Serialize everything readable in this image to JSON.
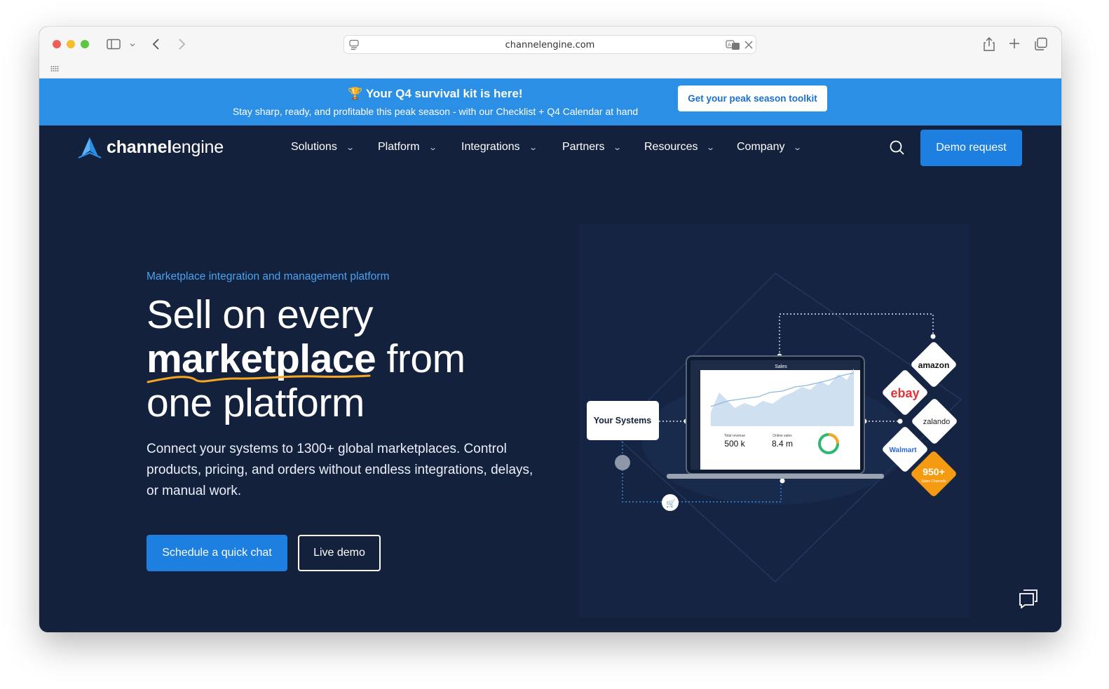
{
  "browser": {
    "url": "channelengine.com",
    "icons": [
      "sidebar-icon",
      "chevron-down-icon",
      "back-icon",
      "forward-icon",
      "page-menu-icon",
      "translate-icon",
      "close-icon",
      "share-icon",
      "new-tab-icon",
      "tabs-overview-icon",
      "extensions-grid-icon"
    ]
  },
  "banner": {
    "title": "🏆 Your Q4 survival kit is here!",
    "subtitle": "Stay sharp, ready, and profitable this peak season - with our Checklist + Q4 Calendar at hand",
    "button": "Get your peak season toolkit",
    "color": "#2b8fe5"
  },
  "nav": {
    "logo_bold": "channel",
    "logo_light": "engine",
    "items": [
      {
        "label": "Solutions"
      },
      {
        "label": "Platform"
      },
      {
        "label": "Integrations"
      },
      {
        "label": "Partners"
      },
      {
        "label": "Resources"
      },
      {
        "label": "Company"
      }
    ],
    "demo_button": "Demo request"
  },
  "hero": {
    "eyebrow": "Marketplace integration and management platform",
    "line1": "Sell on every",
    "line2_bold": "marketplace",
    "line2_rest": " from",
    "line3": "one platform",
    "lead": "Connect your systems to 1300+ global marketplaces. Control products, pricing, and orders without endless integrations, delays, or manual work.",
    "cta_primary": "Schedule a quick chat",
    "cta_secondary": "Live demo"
  },
  "illustration": {
    "your_systems": "Your Systems",
    "screen_title": "Sales",
    "stat1_label": "Total revenue",
    "stat1_value": "500 k",
    "stat2_label": "Online sales",
    "stat2_value": "8.4 m",
    "channels": [
      "amazon",
      "ebay",
      "zalando",
      "Walmart",
      "950+"
    ],
    "channels_sub": "Sales Channels"
  },
  "colors": {
    "page_bg": "#14213d",
    "accent": "#1d7fe0",
    "eyebrow": "#4aa3f0",
    "underline": "#f5a623"
  }
}
